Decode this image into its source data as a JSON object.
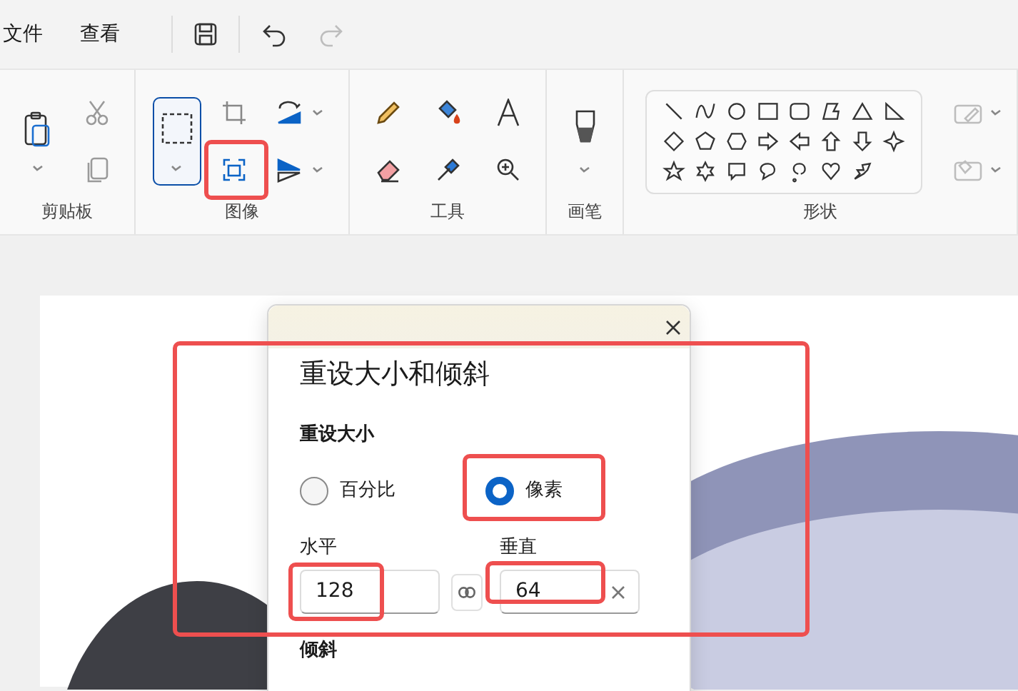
{
  "menu": [
    {
      "label": "文件"
    },
    {
      "label": "查看"
    }
  ],
  "ribbon": {
    "groups": [
      {
        "kind": "clipboard",
        "label": "剪贴板"
      },
      {
        "kind": "image",
        "label": "图像"
      },
      {
        "kind": "tools",
        "label": "工具"
      },
      {
        "kind": "brushes",
        "label": "画笔"
      },
      {
        "kind": "shapes",
        "label": "形状"
      }
    ]
  },
  "dialog": {
    "title": "重设大小和倾斜",
    "resize": {
      "heading": "重设大小",
      "units": [
        {
          "label": "百分比",
          "selected": false
        },
        {
          "label": "像素",
          "selected": true
        }
      ],
      "fields": [
        {
          "label": "水平",
          "value": "128"
        },
        {
          "label": "垂直",
          "value": "64"
        }
      ]
    },
    "skew": {
      "heading": "倾斜"
    }
  }
}
